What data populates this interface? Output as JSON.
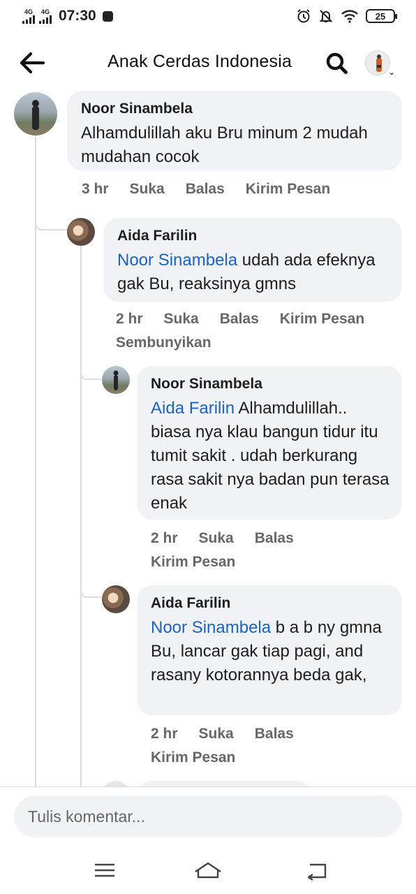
{
  "status_bar": {
    "network_1": "4G",
    "network_2": "4G",
    "time": "07:30",
    "battery": "25",
    "icons": [
      "alarm-icon",
      "mute-bell-icon",
      "wifi-icon",
      "battery-icon"
    ]
  },
  "header": {
    "title": "Anak Cerdas Indonesia",
    "icons": [
      "back-arrow-icon",
      "search-icon",
      "profile-avatar-icon",
      "chevron-down-icon"
    ]
  },
  "comments": [
    {
      "author": "Noor Sinambela",
      "mention": "",
      "text": "Alhamdulillah aku Bru minum 2 mudah mudahan cocok",
      "time": "3 hr",
      "like": "Suka",
      "reply": "Balas",
      "message": "Kirim Pesan"
    },
    {
      "author": "Aida Farilin",
      "mention": "Noor Sinambela",
      "text": "udah ada efeknya gak Bu, reaksinya gmns",
      "time": "2 hr",
      "like": "Suka",
      "reply": "Balas",
      "message": "Kirim Pesan",
      "hide": "Sembunyikan"
    },
    {
      "author": "Noor Sinambela",
      "mention": "Aida Farilin",
      "text": "Alhamdulillah.. biasa nya klau bangun tidur itu tumit sakit . udah berkurang rasa sakit nya badan pun terasa enak",
      "time": "2 hr",
      "like": "Suka",
      "reply": "Balas",
      "message": "Kirim Pesan"
    },
    {
      "author": "Aida Farilin",
      "mention": "Noor Sinambela",
      "text": "b a b ny gmna Bu, lancar gak tiap pagi, and rasany kotorannya beda gak,",
      "time": "2 hr",
      "like": "Suka",
      "reply": "Balas",
      "message": "Kirim Pesan"
    }
  ],
  "composer": {
    "placeholder": "Tulis komentar..."
  },
  "nav": {
    "icons": [
      "menu-icon",
      "home-icon",
      "back-icon"
    ]
  },
  "colors": {
    "bubble": "#f0f2f5",
    "mention": "#1b63c4",
    "meta": "#65676b",
    "thread_line": "#dadde1"
  }
}
